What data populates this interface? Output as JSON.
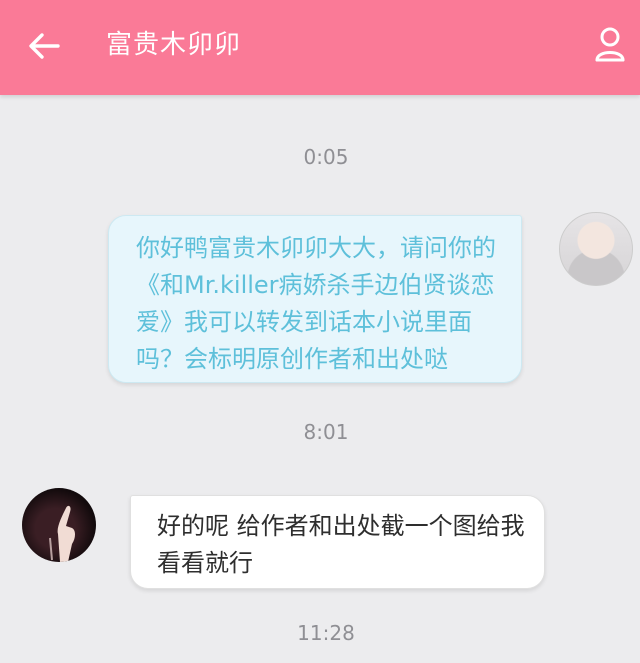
{
  "header": {
    "title": "富贵木卯卯",
    "back_icon": "arrow-left-icon",
    "profile_icon": "user-icon",
    "background_color": "#fa7a97"
  },
  "messages": [
    {
      "time": "0:05",
      "side": "right",
      "text": "你好鸭富贵木卯卯大大，请问你的《和Mr.killer病娇杀手边伯贤谈恋爱》我可以转发到话本小说里面吗？会标明原创作者和出处哒"
    },
    {
      "time": "8:01",
      "side": "left",
      "text": "好的呢 给作者和出处截一个图给我看看就行"
    }
  ],
  "last_time": "11:28"
}
